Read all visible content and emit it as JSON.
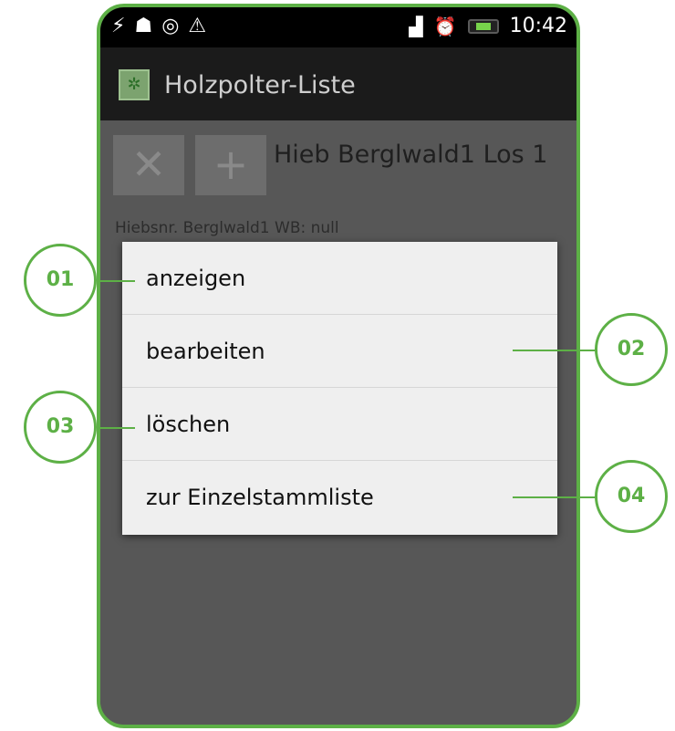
{
  "statusbar": {
    "icons_left": [
      "usb-icon",
      "android-debug-icon",
      "location-icon",
      "warning-icon"
    ],
    "icons_right": [
      "signal-icon",
      "alarm-icon",
      "battery-icon"
    ],
    "time": "10:42"
  },
  "actionbar": {
    "title": "Holzpolter-Liste"
  },
  "toolbar": {
    "delete_symbol": "✕",
    "add_symbol": "+",
    "list_title": "Hieb Berglwald1 Los 1"
  },
  "list": {
    "subtitle": "Hiebsnr. Berglwald1 WB: null"
  },
  "context_menu": {
    "items": [
      {
        "label": "anzeigen"
      },
      {
        "label": "bearbeiten"
      },
      {
        "label": "löschen"
      },
      {
        "label": "zur Einzelstammliste"
      }
    ]
  },
  "callouts": [
    {
      "label": "01"
    },
    {
      "label": "02"
    },
    {
      "label": "03"
    },
    {
      "label": "04"
    }
  ],
  "colors": {
    "accent": "#5db046",
    "frame": "#5db046",
    "dialog_bg": "#efefef",
    "content_bg": "#575757"
  }
}
